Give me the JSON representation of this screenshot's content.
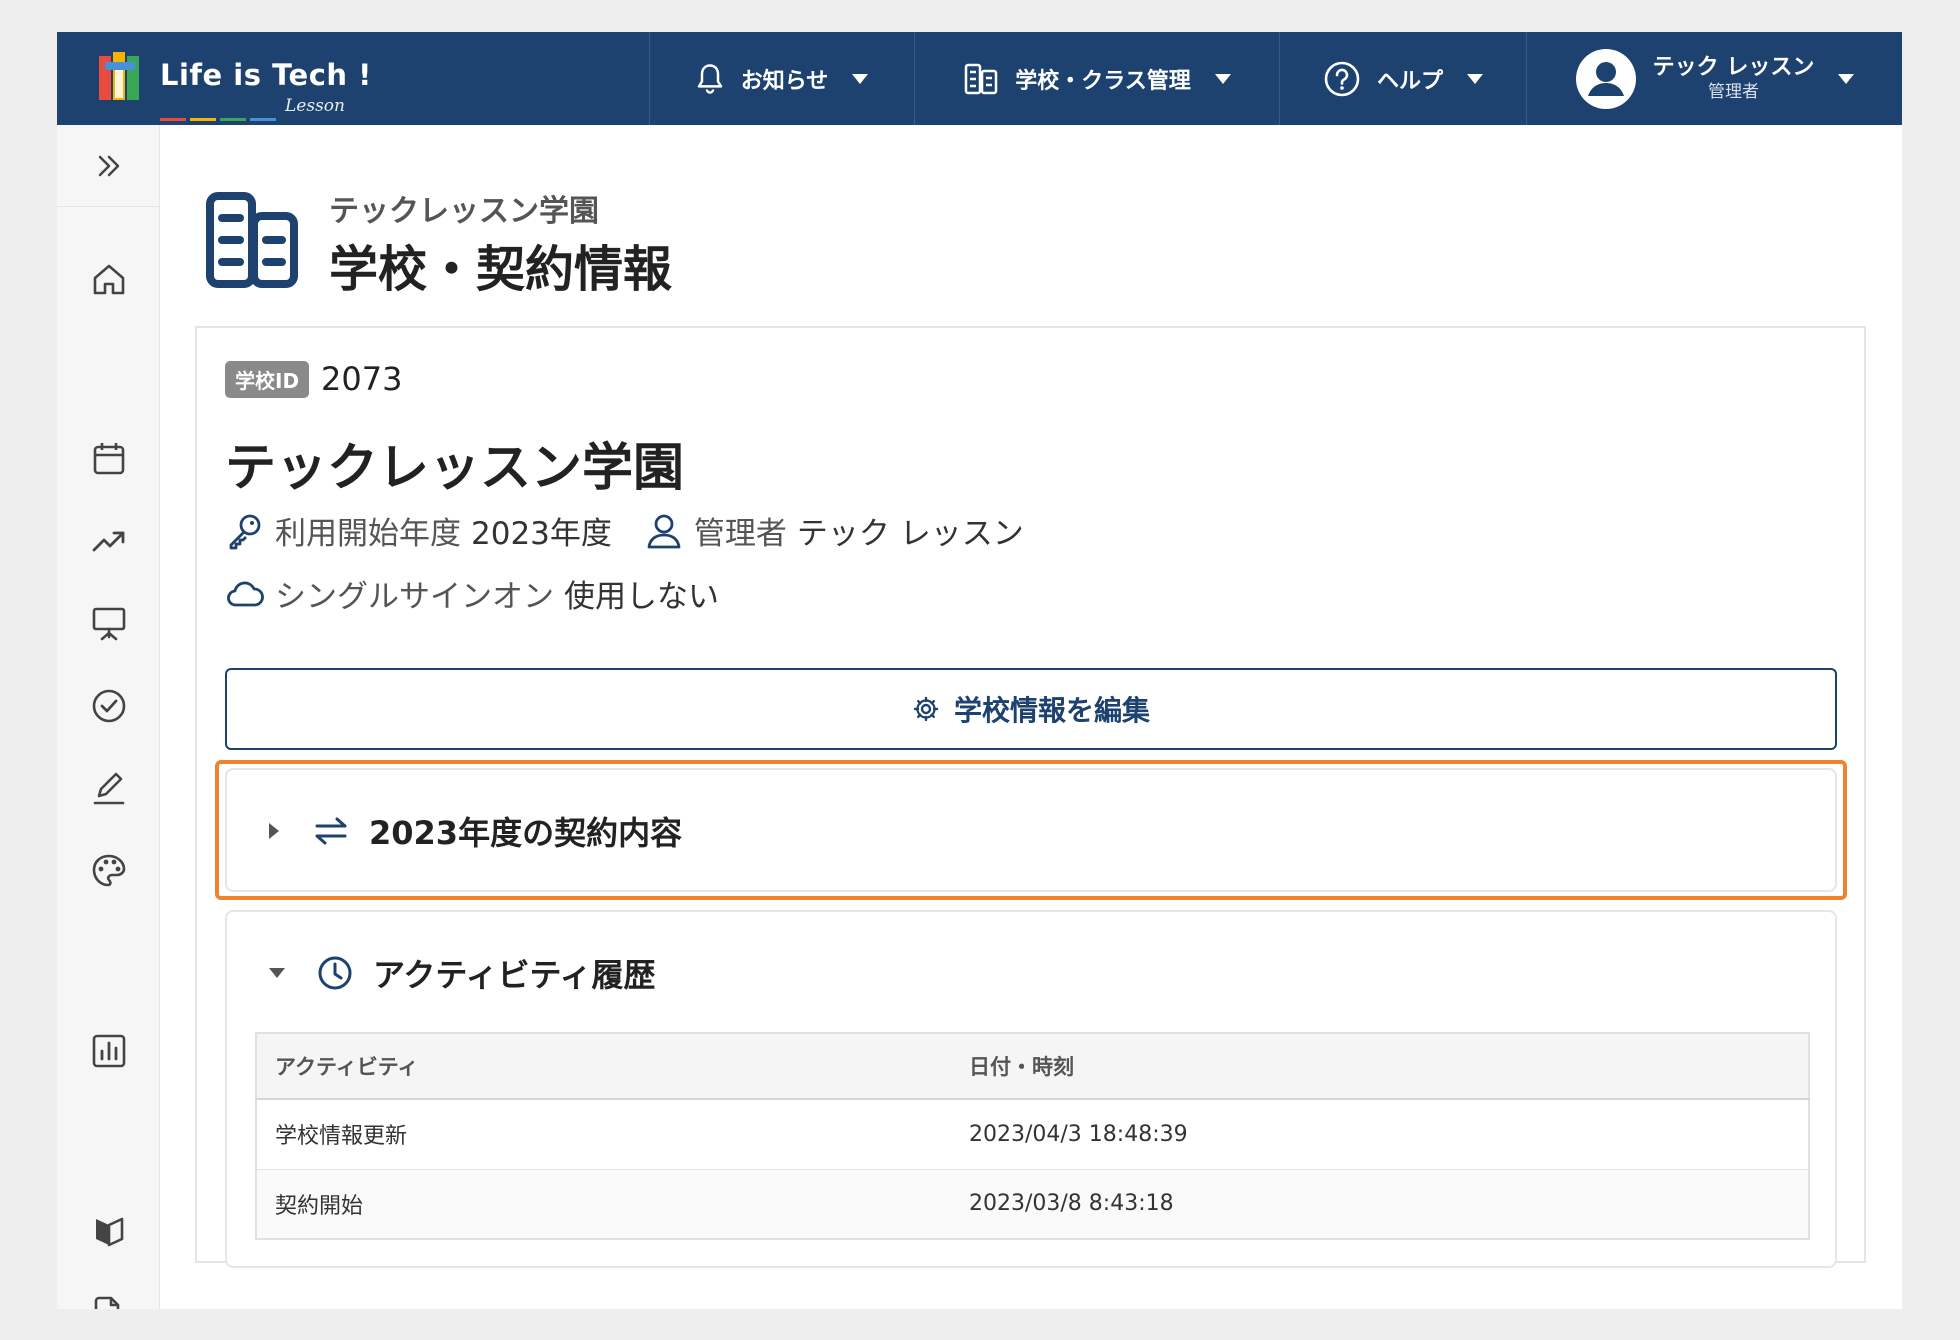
{
  "header": {
    "logo_text": "Life is Tech !",
    "logo_sub": "Lesson",
    "nav": {
      "notice": "お知らせ",
      "school_management": "学校・クラス管理",
      "help": "ヘルプ"
    },
    "user": {
      "name": "テック レッスン",
      "role": "管理者"
    }
  },
  "sidebar": {
    "icons": [
      "expand-icon",
      "home-icon",
      "calendar-icon",
      "trend-icon",
      "presentation-icon",
      "check-circle-icon",
      "pencil-icon",
      "palette-icon",
      "bar-chart-icon",
      "beginner-mark-icon",
      "document-edit-icon"
    ]
  },
  "page": {
    "school": "テックレッスン学園",
    "title": "学校・契約情報"
  },
  "card": {
    "id_badge": "学校ID",
    "id_value": "2073",
    "school_name": "テックレッスン学園",
    "start_year_label": "利用開始年度",
    "start_year_value": "2023年度",
    "admin_label": "管理者",
    "admin_value": "テック レッスン",
    "sso_label": "シングルサインオン",
    "sso_value": "使用しない",
    "edit_button": "学校情報を編集"
  },
  "contract": {
    "title": "2023年度の契約内容"
  },
  "activity": {
    "title": "アクティビティ履歴",
    "columns": [
      "アクティビティ",
      "日付・時刻"
    ],
    "rows": [
      {
        "activity": "学校情報更新",
        "datetime": "2023/04/3 18:48:39"
      },
      {
        "activity": "契約開始",
        "datetime": "2023/03/8 8:43:18"
      }
    ]
  },
  "colors": {
    "header_bg": "#1d426f",
    "highlight": "#ee8430",
    "accent": "#1d426f"
  }
}
